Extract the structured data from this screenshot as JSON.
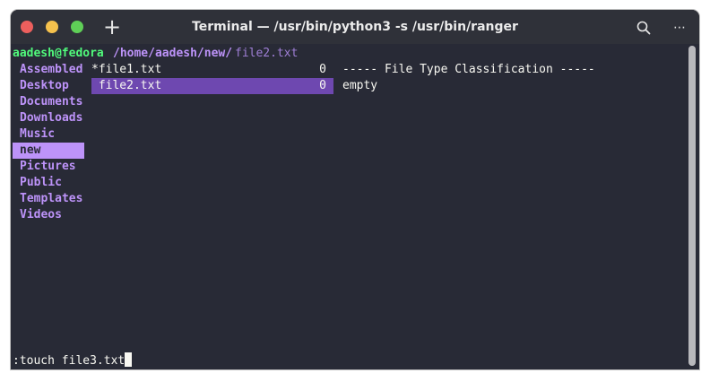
{
  "window": {
    "title": "Terminal — /usr/bin/python3 -s /usr/bin/ranger",
    "new_tab_glyph": "+",
    "more_glyph": "⋯"
  },
  "header": {
    "user_host": "aadesh@fedora",
    "path": "/home/aadesh/new/",
    "file": "file2.txt"
  },
  "parent_dirs": [
    {
      "label": "Assembled"
    },
    {
      "label": "Desktop"
    },
    {
      "label": "Documents"
    },
    {
      "label": "Downloads"
    },
    {
      "label": "Music"
    },
    {
      "label": "new"
    },
    {
      "label": "Pictures"
    },
    {
      "label": "Public"
    },
    {
      "label": "Templates"
    },
    {
      "label": "Videos"
    }
  ],
  "selected_dir": "new",
  "files": [
    {
      "name": "*file1.txt",
      "size": "0"
    },
    {
      "name": " file2.txt",
      "size": "0"
    }
  ],
  "preview": {
    "line1": "----- File Type Classification -----",
    "line2": "empty"
  },
  "command": ":touch file3.txt",
  "colors": {
    "background": "#282a36",
    "dir": "#bd93f9",
    "user": "#50fa7b",
    "selection": "#6e48b0"
  },
  "icons": {
    "search": "search-icon",
    "more": "more-icon",
    "new_tab": "plus-icon"
  }
}
